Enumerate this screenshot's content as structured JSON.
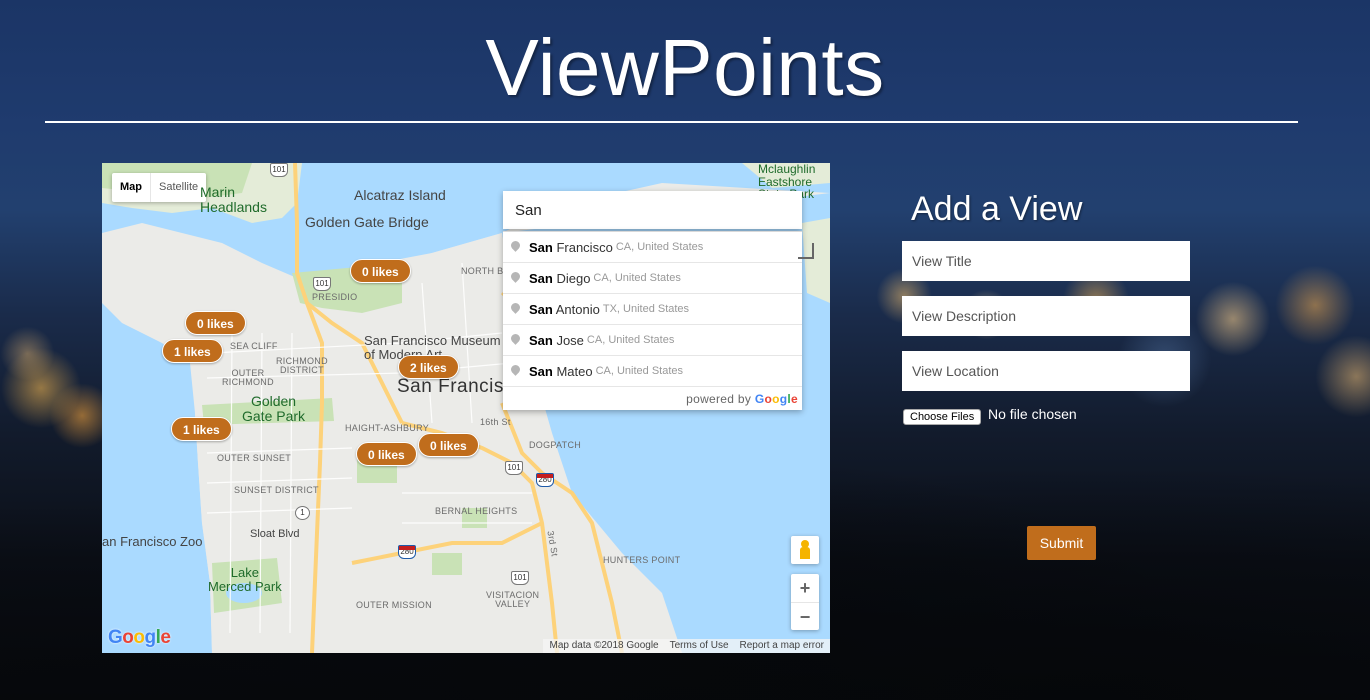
{
  "site": {
    "title": "ViewPoints"
  },
  "map": {
    "type_control": {
      "map": "Map",
      "satellite": "Satellite"
    },
    "labels": {
      "alcatraz": "Alcatraz Island",
      "golden_gate_bridge": "Golden Gate Bridge",
      "marin_headlands": "Marin\nHeadlands",
      "presidio": "PRESIDIO",
      "north_beach": "NORTH BE",
      "sea_cliff": "SEA CLIFF",
      "richmond_district": "RICHMOND\nDISTRICT",
      "outer_richmond": "OUTER\nRICHMOND",
      "sf_museum": "San Francisco Museum\nof Modern Art",
      "san_francisco": "San Francisco",
      "golden_gate_park": "Golden\nGate Park",
      "haight_ashbury": "HAIGHT-ASHBURY",
      "outer_sunset": "OUTER SUNSET",
      "sunset_district": "SUNSET DISTRICT",
      "dogpatch": "DOGPATCH",
      "bernal_heights": "BERNAL HEIGHTS",
      "sf_zoo": "an Francisco Zoo",
      "sloat_blvd": "Sloat Blvd",
      "lake_merced": "Lake\nMerced Park",
      "hunters_point": "HUNTERS POINT",
      "outer_mission": "OUTER MISSION",
      "visitacion_valley": "VISITACION\nVALLEY",
      "mclaughlin": "Mclaughlin\nEastshore\nState Park",
      "street_16th": "16th St",
      "third_st": "3rd St"
    },
    "highways": {
      "h101": "101",
      "h280": "280",
      "h1": "1"
    },
    "markers": [
      {
        "label": "0 likes"
      },
      {
        "label": "0 likes"
      },
      {
        "label": "1 likes"
      },
      {
        "label": "2 likes"
      },
      {
        "label": "1 likes"
      },
      {
        "label": "0 likes"
      },
      {
        "label": "0 likes"
      }
    ],
    "search": {
      "value": "San",
      "suggestions": [
        {
          "match": "San",
          "rest": " Francisco",
          "secondary": "CA, United States"
        },
        {
          "match": "San",
          "rest": " Diego",
          "secondary": "CA, United States"
        },
        {
          "match": "San",
          "rest": " Antonio",
          "secondary": "TX, United States"
        },
        {
          "match": "San",
          "rest": " Jose",
          "secondary": "CA, United States"
        },
        {
          "match": "San",
          "rest": " Mateo",
          "secondary": "CA, United States"
        }
      ],
      "powered_by": "powered by",
      "google": [
        "G",
        "o",
        "o",
        "g",
        "l",
        "e"
      ]
    },
    "logo": [
      "G",
      "o",
      "o",
      "g",
      "l",
      "e"
    ],
    "zoom_in": "+",
    "zoom_out": "−",
    "attribution": {
      "data": "Map data ©2018 Google",
      "terms": "Terms of Use",
      "report": "Report a map error"
    }
  },
  "form": {
    "title": "Add a View",
    "view_title_placeholder": "View Title",
    "view_description_placeholder": "View Description",
    "view_location_placeholder": "View Location",
    "choose_files": "Choose Files",
    "file_status": "No file chosen",
    "submit": "Submit"
  },
  "colors": {
    "accent": "#c06d1c",
    "header_bg": "#1f3b6e"
  }
}
